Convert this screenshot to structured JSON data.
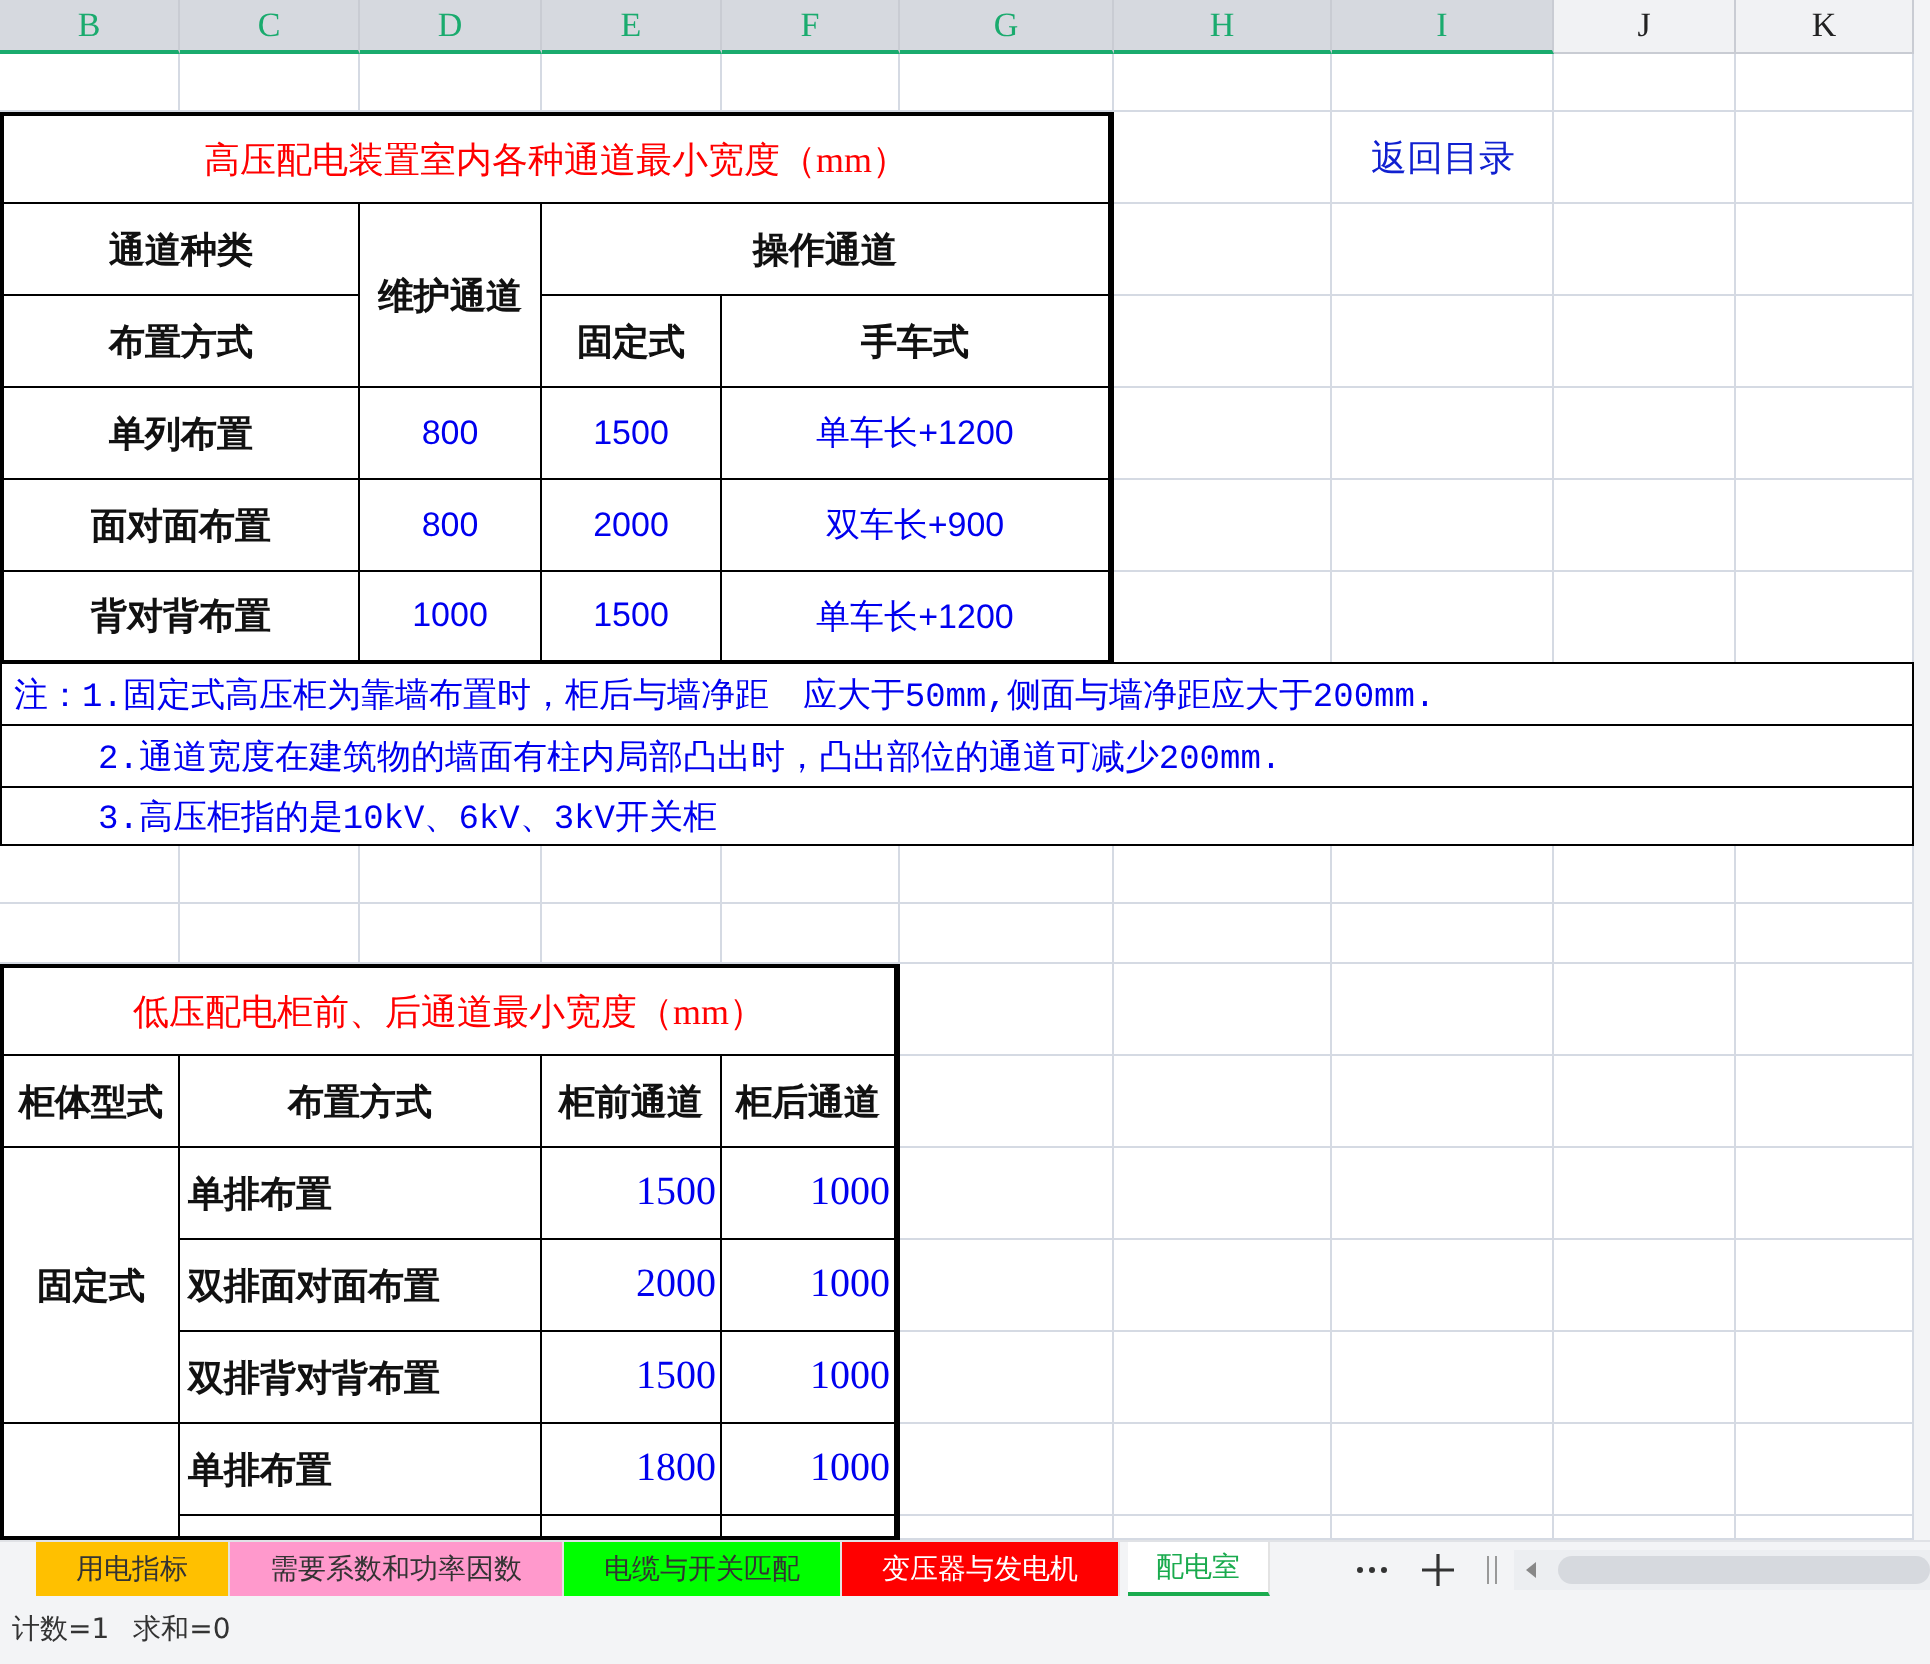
{
  "column_headers": [
    {
      "label": "B",
      "selected": true
    },
    {
      "label": "C",
      "selected": true
    },
    {
      "label": "D",
      "selected": true
    },
    {
      "label": "E",
      "selected": true
    },
    {
      "label": "F",
      "selected": true
    },
    {
      "label": "G",
      "selected": true
    },
    {
      "label": "H",
      "selected": true
    },
    {
      "label": "I",
      "selected": true
    },
    {
      "label": "J",
      "selected": false
    },
    {
      "label": "K",
      "selected": false
    }
  ],
  "high_voltage_table": {
    "title": "高压配电装置室内各种通道最小宽度（mm）",
    "header": {
      "channel_type": "通道种类",
      "maintenance": "维护通道",
      "operation": "操作通道",
      "layout": "布置方式",
      "fixed": "固定式",
      "cart": "手车式"
    },
    "rows": [
      {
        "layout": "单列布置",
        "maintenance": "800",
        "fixed": "1500",
        "cart": "单车长+1200"
      },
      {
        "layout": "面对面布置",
        "maintenance": "800",
        "fixed": "2000",
        "cart": "双车长+900"
      },
      {
        "layout": "背对背布置",
        "maintenance": "1000",
        "fixed": "1500",
        "cart": "单车长+1200"
      }
    ]
  },
  "back_link": "返回目录",
  "notes": [
    {
      "text": "注：1.固定式高压柜为靠墙布置时，柜后与墙净距　应大于50mm,侧面与墙净距应大于200mm.",
      "indented": false
    },
    {
      "text": "2.通道宽度在建筑物的墙面有柱内局部凸出时，凸出部位的通道可减少200mm.",
      "indented": true
    },
    {
      "text": "3.高压柜指的是10kV、6kV、3kV开关柜",
      "indented": true
    }
  ],
  "low_voltage_table": {
    "title": "低压配电柜前、后通道最小宽度（mm）",
    "header": {
      "cabinet_type": "柜体型式",
      "layout": "布置方式",
      "front": "柜前通道",
      "rear": "柜后通道"
    },
    "groups": [
      {
        "cabinet_type": "固定式",
        "rows": [
          {
            "layout": "单排布置",
            "front": "1500",
            "rear": "1000"
          },
          {
            "layout": "双排面对面布置",
            "front": "2000",
            "rear": "1000"
          },
          {
            "layout": "双排背对背布置",
            "front": "1500",
            "rear": "1000"
          }
        ]
      },
      {
        "rows": [
          {
            "layout": "单排布置",
            "front": "1800",
            "rear": "1000"
          }
        ]
      }
    ]
  },
  "sheet_tabs": [
    {
      "label": "用电指标",
      "color": "#ffc000",
      "selected": false
    },
    {
      "label": "需要系数和功率因数",
      "color": "#ff99cc",
      "selected": false
    },
    {
      "label": "电缆与开关匹配",
      "color": "#00ff00",
      "selected": false
    },
    {
      "label": "变压器与发电机",
      "color": "#ff0000",
      "selected": false
    },
    {
      "label": "配电室",
      "selected": true
    }
  ],
  "status": [
    "计数=1",
    "求和=0"
  ]
}
